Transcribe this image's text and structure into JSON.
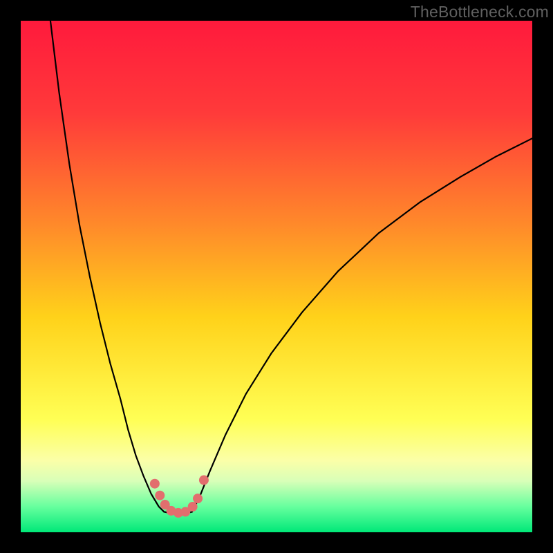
{
  "watermark": "TheBottleneck.com",
  "chart_data": {
    "type": "line",
    "title": "",
    "xlabel": "",
    "ylabel": "",
    "xlim": [
      0,
      100
    ],
    "ylim": [
      0,
      100
    ],
    "background_gradient": {
      "stops": [
        {
          "offset": 0.0,
          "color": "#ff1a3c"
        },
        {
          "offset": 0.18,
          "color": "#ff3a3a"
        },
        {
          "offset": 0.4,
          "color": "#ff8a2a"
        },
        {
          "offset": 0.58,
          "color": "#ffd21a"
        },
        {
          "offset": 0.78,
          "color": "#ffff55"
        },
        {
          "offset": 0.86,
          "color": "#fbffa8"
        },
        {
          "offset": 0.9,
          "color": "#d8ffb8"
        },
        {
          "offset": 0.95,
          "color": "#66ff9e"
        },
        {
          "offset": 1.0,
          "color": "#00e878"
        }
      ]
    },
    "series": [
      {
        "name": "curve-left",
        "stroke": "#000000",
        "stroke_width": 2.2,
        "x": [
          5.8,
          7.5,
          9.5,
          11.5,
          13.5,
          15.5,
          17.5,
          19.5,
          21.0,
          22.5,
          24.0,
          25.5,
          27.0,
          28.0
        ],
        "y": [
          100,
          86,
          72,
          60,
          50,
          41,
          33,
          26,
          20,
          15,
          11,
          7.5,
          5.0,
          4.0
        ]
      },
      {
        "name": "curve-flat",
        "stroke": "#000000",
        "stroke_width": 2.2,
        "x": [
          28.0,
          30.0,
          32.0,
          33.5
        ],
        "y": [
          4.0,
          3.6,
          3.6,
          4.0
        ]
      },
      {
        "name": "curve-right",
        "stroke": "#000000",
        "stroke_width": 2.2,
        "x": [
          33.5,
          35.0,
          37.0,
          40.0,
          44.0,
          49.0,
          55.0,
          62.0,
          70.0,
          78.0,
          86.0,
          93.0,
          100.0
        ],
        "y": [
          4.0,
          7.0,
          12.0,
          19.0,
          27.0,
          35.0,
          43.0,
          51.0,
          58.5,
          64.5,
          69.5,
          73.5,
          77.0
        ]
      }
    ],
    "markers": {
      "color": "#e26e6e",
      "radius": 7,
      "points": [
        {
          "x": 26.2,
          "y": 9.5
        },
        {
          "x": 27.2,
          "y": 7.2
        },
        {
          "x": 28.2,
          "y": 5.4
        },
        {
          "x": 29.4,
          "y": 4.2
        },
        {
          "x": 30.8,
          "y": 3.8
        },
        {
          "x": 32.2,
          "y": 4.0
        },
        {
          "x": 33.6,
          "y": 5.0
        },
        {
          "x": 34.6,
          "y": 6.6
        },
        {
          "x": 35.8,
          "y": 10.2
        }
      ]
    }
  }
}
